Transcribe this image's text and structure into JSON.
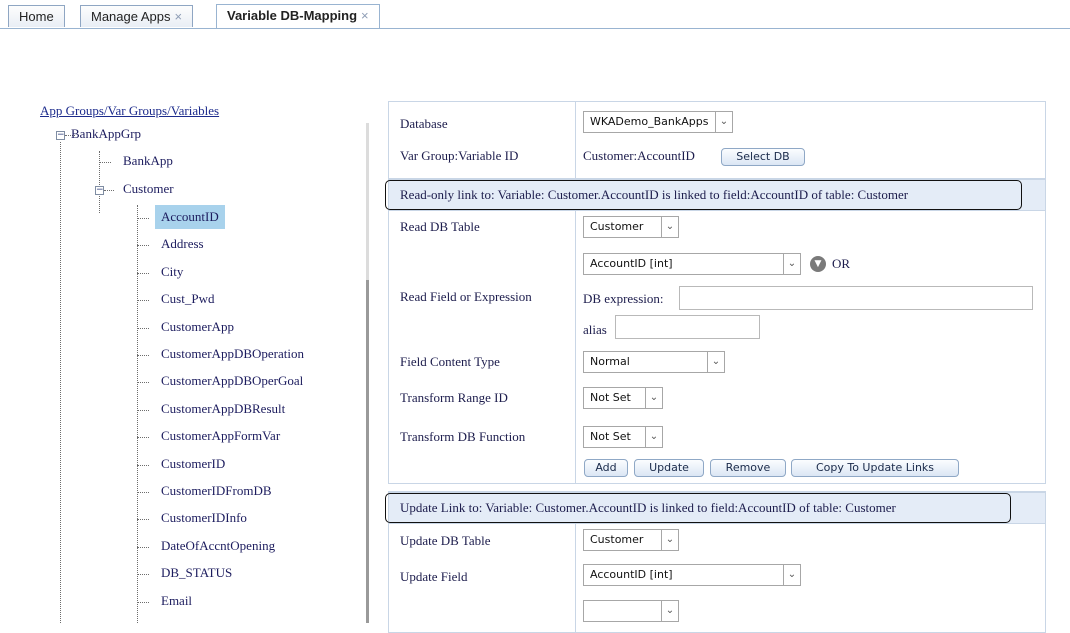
{
  "tabs": [
    {
      "label": "Home",
      "closable": false,
      "active": false
    },
    {
      "label": "Manage Apps",
      "closable": true,
      "active": false
    },
    {
      "label": "Variable DB-Mapping",
      "closable": true,
      "active": true
    }
  ],
  "close_glyph": "×",
  "tree": {
    "root_link": "App Groups/Var Groups/Variables",
    "group": "BankAppGrp",
    "apps": [
      "BankApp",
      "Customer"
    ],
    "variables": [
      "AccountID",
      "Address",
      "City",
      "Cust_Pwd",
      "CustomerApp",
      "CustomerAppDBOperation",
      "CustomerAppDBOperGoal",
      "CustomerAppDBResult",
      "CustomerAppFormVar",
      "CustomerID",
      "CustomerIDFromDB",
      "CustomerIDInfo",
      "DateOfAccntOpening",
      "DB_STATUS",
      "Email"
    ],
    "selected": "AccountID",
    "expander_glyph": "−"
  },
  "top_panel": {
    "database_label": "Database",
    "database_value": "WKADemo_BankApps",
    "var_label": "Var Group:Variable ID",
    "var_value": "Customer:AccountID",
    "select_db_button": "Select DB"
  },
  "read_link": {
    "header": "Read-only link to: Variable: Customer.AccountID is linked to field:AccountID of table: Customer",
    "table_label": "Read DB Table",
    "table_value": "Customer",
    "field_label": "Read Field or Expression",
    "field_value": "AccountID [int]",
    "or_text": "OR",
    "expr_label": "DB expression:",
    "alias_label": "alias",
    "content_type_label": "Field Content Type",
    "content_type_value": "Normal",
    "range_label": "Transform Range ID",
    "range_value": "Not Set",
    "function_label": "Transform DB Function",
    "function_value": "Not Set",
    "buttons": {
      "add": "Add",
      "update": "Update",
      "remove": "Remove",
      "copy": "Copy To Update Links"
    }
  },
  "update_link": {
    "header": "Update Link to: Variable: Customer.AccountID is linked to field:AccountID of table: Customer",
    "table_label": "Update DB Table",
    "table_value": "Customer",
    "field_label": "Update Field",
    "field_value": "AccountID [int]"
  },
  "icons": {
    "dropdown": "chevron-down-icon",
    "or": "chevron-down-circle-icon"
  },
  "colors": {
    "header_bg": "#e4ecf7",
    "selected_bg": "#a8d2ec",
    "link": "#1c2b8c"
  }
}
